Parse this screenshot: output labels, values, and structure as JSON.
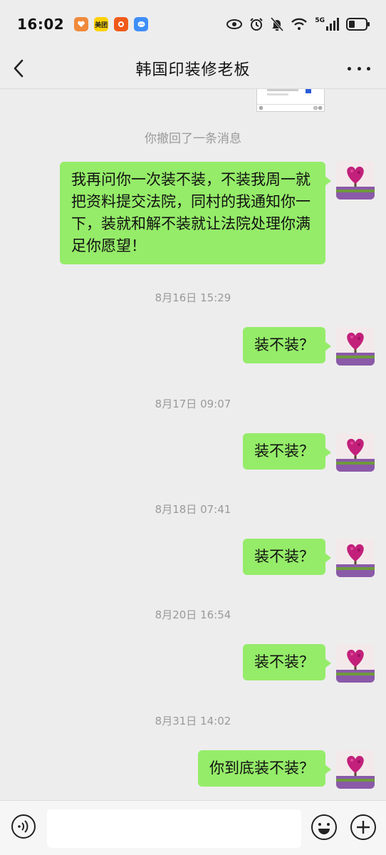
{
  "status_bar": {
    "time": "16:02",
    "apps": [
      {
        "icon": "health-app-icon",
        "label": "",
        "color": "#f08a3c"
      },
      {
        "icon": "meituan-app-icon",
        "label": "美团",
        "color": "#ffd100"
      },
      {
        "icon": "taobao-app-icon",
        "label": "",
        "color": "#f05a1a"
      },
      {
        "icon": "message-app-icon",
        "label": "",
        "color": "#3e8ef7"
      }
    ],
    "network": "5G"
  },
  "nav": {
    "title": "韩国印装修老板"
  },
  "chat": {
    "recall_notice": "你撤回了一条消息",
    "messages": [
      {
        "text": "我再问你一次装不装，不装我周一就把资料提交法院，同村的我通知你一下，装就和解不装就让法院处理你满足你愿望！"
      },
      {
        "timestamp": "8月16日 15:29",
        "text": "装不装？"
      },
      {
        "timestamp": "8月17日 09:07",
        "text": "装不装？"
      },
      {
        "timestamp": "8月18日 07:41",
        "text": "装不装？"
      },
      {
        "timestamp": "8月20日 16:54",
        "text": "装不装？"
      },
      {
        "timestamp": "8月31日 14:02",
        "text": "你到底装不装？"
      }
    ]
  },
  "colors": {
    "bubble": "#95ec69",
    "background": "#ededed"
  }
}
